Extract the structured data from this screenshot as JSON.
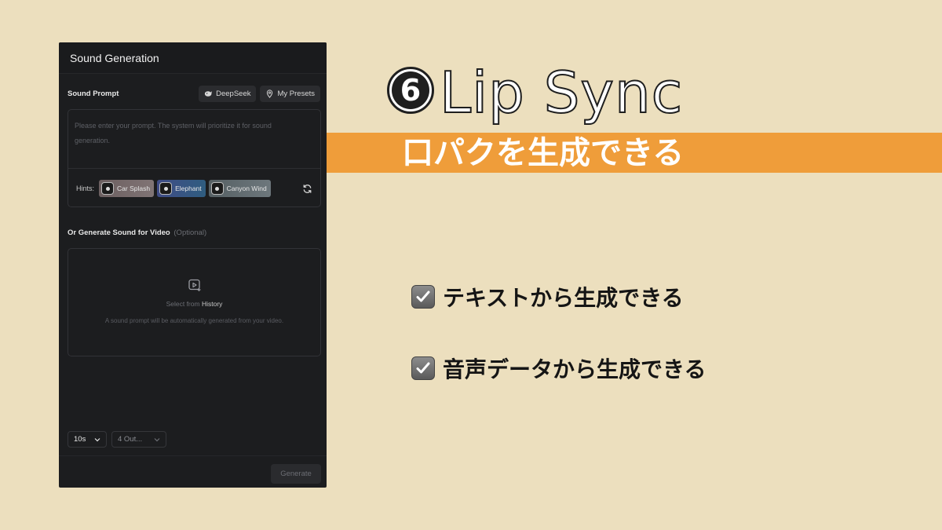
{
  "panel": {
    "title": "Sound Generation",
    "sound_prompt_label": "Sound Prompt",
    "deepseek_label": "DeepSeek",
    "presets_label": "My Presets",
    "prompt_placeholder": "Please enter your prompt. The system will prioritize it for sound generation.",
    "hints_label": "Hints:",
    "hints": [
      {
        "label": "Car Splash"
      },
      {
        "label": "Elephant"
      },
      {
        "label": "Canyon Wind"
      }
    ],
    "video_label": "Or Generate Sound for Video",
    "video_optional": "(Optional)",
    "select_from": "Select from",
    "history": "History",
    "video_hint": "A sound prompt will be automatically generated from your video.",
    "duration": "10s",
    "outputs": "4 Out...",
    "generate_label": "Generate"
  },
  "slide": {
    "step_number": "6",
    "headline": "Lip Sync",
    "banner": "口パクを生成できる",
    "bullets": [
      {
        "text": "テキストから生成できる"
      },
      {
        "text": "音声データから生成できる"
      }
    ]
  },
  "colors": {
    "background": "#ecdfbe",
    "banner": "#ef9d3a",
    "panel": "#1c1d1f"
  }
}
